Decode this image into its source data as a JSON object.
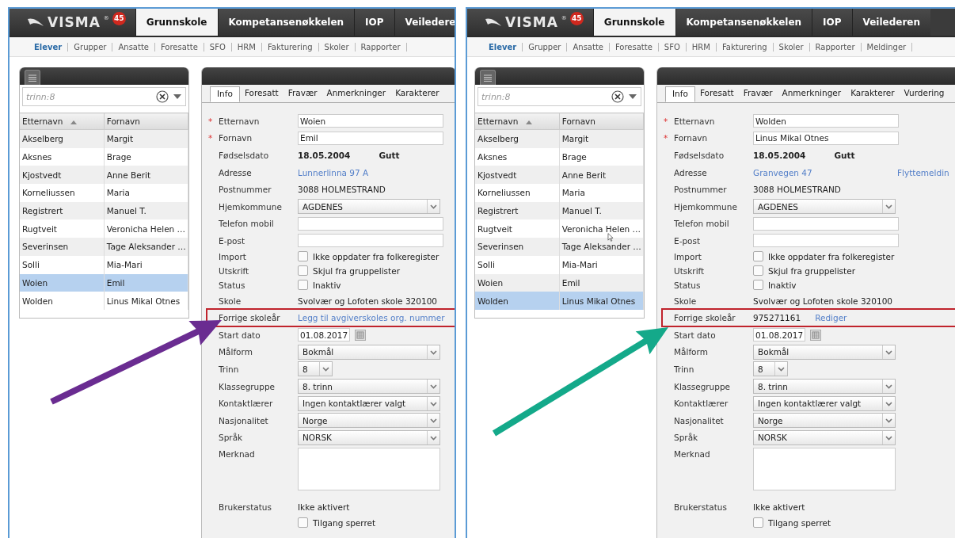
{
  "screens": [
    {
      "logo": {
        "text": "VISMA",
        "mark": "®",
        "badge": "45"
      },
      "top_tabs": [
        {
          "label": "Grunnskole",
          "selected": true
        },
        {
          "label": "Kompetansenøkkelen",
          "selected": false
        },
        {
          "label": "IOP",
          "selected": false
        },
        {
          "label": "Veiledere",
          "selected": false
        }
      ],
      "sub_nav": [
        {
          "label": "Elever",
          "selected": true
        },
        {
          "label": "Grupper",
          "selected": false
        },
        {
          "label": "Ansatte",
          "selected": false
        },
        {
          "label": "Foresatte",
          "selected": false
        },
        {
          "label": "SFO",
          "selected": false
        },
        {
          "label": "HRM",
          "selected": false
        },
        {
          "label": "Fakturering",
          "selected": false
        },
        {
          "label": "Skoler",
          "selected": false
        },
        {
          "label": "Rapporter",
          "selected": false
        }
      ],
      "search": {
        "placeholder": "trinn:8"
      },
      "list": {
        "columns": [
          {
            "label": "Etternavn",
            "sorted": true
          },
          {
            "label": "Fornavn",
            "sorted": false
          }
        ],
        "rows": [
          {
            "cells": [
              "Akselberg",
              "Margit"
            ],
            "selected": false
          },
          {
            "cells": [
              "Aksnes",
              "Brage"
            ],
            "selected": false
          },
          {
            "cells": [
              "Kjostvedt",
              "Anne Berit"
            ],
            "selected": false
          },
          {
            "cells": [
              "Korneliussen",
              "Maria"
            ],
            "selected": false
          },
          {
            "cells": [
              "Registrert",
              "Manuel T."
            ],
            "selected": false
          },
          {
            "cells": [
              "Rugtveit",
              "Veronicha Helen …"
            ],
            "selected": false
          },
          {
            "cells": [
              "Severinsen",
              "Tage Aleksander …"
            ],
            "selected": false
          },
          {
            "cells": [
              "Solli",
              "Mia-Mari"
            ],
            "selected": false
          },
          {
            "cells": [
              "Woien",
              "Emil"
            ],
            "selected": true
          },
          {
            "cells": [
              "Wolden",
              "Linus Mikal Otnes"
            ],
            "selected": false
          }
        ]
      },
      "detail_tabs": [
        {
          "label": "Info",
          "selected": true
        },
        {
          "label": "Foresatt",
          "selected": false
        },
        {
          "label": "Fravær",
          "selected": false
        },
        {
          "label": "Anmerkninger",
          "selected": false
        },
        {
          "label": "Karakterer",
          "selected": false
        }
      ],
      "fields": [
        {
          "kind": "input",
          "marker": "*",
          "label": "Etternavn",
          "value": "Woien"
        },
        {
          "kind": "input",
          "marker": "*",
          "label": "Fornavn",
          "value": "Emil"
        },
        {
          "kind": "birth",
          "label": "Fødselsdato",
          "value": "18.05.2004",
          "extra": "Gutt"
        },
        {
          "kind": "link",
          "label": "Adresse",
          "value": "Lunnerlinna 97 A"
        },
        {
          "kind": "text",
          "label": "Postnummer",
          "value": "3088 HOLMESTRAND"
        },
        {
          "kind": "select",
          "label": "Hjemkommune",
          "value": "AGDENES"
        },
        {
          "kind": "input",
          "label": "Telefon mobil"
        },
        {
          "kind": "input",
          "label": "E-post"
        },
        {
          "kind": "checkbox",
          "label": "Import",
          "value": "Ikke oppdater fra folkeregister",
          "checked": false
        },
        {
          "kind": "checkbox",
          "label": "Utskrift",
          "value": "Skjul fra gruppelister",
          "checked": false
        },
        {
          "kind": "checkbox",
          "label": "Status",
          "value": "Inaktiv",
          "checked": false
        },
        {
          "kind": "text",
          "label": "Skole",
          "value": "Svolvær og Lofoten skole 320100"
        },
        {
          "kind": "link",
          "label": "Forrige skoleår",
          "value": "Legg til avgiverskoles org. nummer",
          "highlighted": true
        },
        {
          "kind": "date",
          "label": "Start dato",
          "value": "01.08.2017"
        },
        {
          "kind": "select",
          "label": "Målform",
          "value": "Bokmål"
        },
        {
          "kind": "small-select",
          "label": "Trinn",
          "value": "8"
        },
        {
          "kind": "select",
          "label": "Klassegruppe",
          "value": "8. trinn"
        },
        {
          "kind": "select",
          "label": "Kontaktlærer",
          "value": "Ingen kontaktlærer valgt"
        },
        {
          "kind": "select",
          "label": "Nasjonalitet",
          "value": "Norge"
        },
        {
          "kind": "select",
          "label": "Språk",
          "value": "NORSK"
        },
        {
          "kind": "textarea",
          "label": "Merknad"
        },
        {
          "kind": "text",
          "label": "Brukerstatus",
          "value": "Ikke aktivert"
        },
        {
          "kind": "checkbox",
          "value": "Tilgang sperret",
          "checked": false
        }
      ],
      "arrow": {
        "color": "#6a2c91"
      }
    },
    {
      "logo": {
        "text": "VISMA",
        "mark": "®",
        "badge": "45"
      },
      "top_tabs": [
        {
          "label": "Grunnskole",
          "selected": true
        },
        {
          "label": "Kompetansenøkkelen",
          "selected": false
        },
        {
          "label": "IOP",
          "selected": false
        },
        {
          "label": "Veilederen",
          "selected": false
        }
      ],
      "sub_nav": [
        {
          "label": "Elever",
          "selected": true
        },
        {
          "label": "Grupper",
          "selected": false
        },
        {
          "label": "Ansatte",
          "selected": false
        },
        {
          "label": "Foresatte",
          "selected": false
        },
        {
          "label": "SFO",
          "selected": false
        },
        {
          "label": "HRM",
          "selected": false
        },
        {
          "label": "Fakturering",
          "selected": false
        },
        {
          "label": "Skoler",
          "selected": false
        },
        {
          "label": "Rapporter",
          "selected": false
        },
        {
          "label": "Meldinger",
          "selected": false
        }
      ],
      "search": {
        "placeholder": "trinn:8"
      },
      "list": {
        "columns": [
          {
            "label": "Etternavn",
            "sorted": true
          },
          {
            "label": "Fornavn",
            "sorted": false
          }
        ],
        "rows": [
          {
            "cells": [
              "Akselberg",
              "Margit"
            ],
            "selected": false
          },
          {
            "cells": [
              "Aksnes",
              "Brage"
            ],
            "selected": false
          },
          {
            "cells": [
              "Kjostvedt",
              "Anne Berit"
            ],
            "selected": false
          },
          {
            "cells": [
              "Korneliussen",
              "Maria"
            ],
            "selected": false
          },
          {
            "cells": [
              "Registrert",
              "Manuel T."
            ],
            "selected": false
          },
          {
            "cells": [
              "Rugtveit",
              "Veronicha Helen …"
            ],
            "selected": false
          },
          {
            "cells": [
              "Severinsen",
              "Tage Aleksander …"
            ],
            "selected": false
          },
          {
            "cells": [
              "Solli",
              "Mia-Mari"
            ],
            "selected": false
          },
          {
            "cells": [
              "Woien",
              "Emil"
            ],
            "selected": false
          },
          {
            "cells": [
              "Wolden",
              "Linus Mikal Otnes"
            ],
            "selected": true
          }
        ]
      },
      "detail_tabs": [
        {
          "label": "Info",
          "selected": true
        },
        {
          "label": "Foresatt",
          "selected": false
        },
        {
          "label": "Fravær",
          "selected": false
        },
        {
          "label": "Anmerkninger",
          "selected": false
        },
        {
          "label": "Karakterer",
          "selected": false
        },
        {
          "label": "Vurdering",
          "selected": false
        }
      ],
      "fields": [
        {
          "kind": "input",
          "marker": "*",
          "label": "Etternavn",
          "value": "Wolden"
        },
        {
          "kind": "input",
          "marker": "*",
          "label": "Fornavn",
          "value": "Linus Mikal Otnes"
        },
        {
          "kind": "birth",
          "label": "Fødselsdato",
          "value": "18.05.2004",
          "extra": "Gutt"
        },
        {
          "kind": "link",
          "label": "Adresse",
          "value": "Granvegen 47",
          "extra": "Flyttemeldin"
        },
        {
          "kind": "text",
          "label": "Postnummer",
          "value": "3088 HOLMESTRAND"
        },
        {
          "kind": "select",
          "label": "Hjemkommune",
          "value": "AGDENES"
        },
        {
          "kind": "input",
          "label": "Telefon mobil"
        },
        {
          "kind": "input",
          "label": "E-post"
        },
        {
          "kind": "checkbox",
          "label": "Import",
          "value": "Ikke oppdater fra folkeregister",
          "checked": false
        },
        {
          "kind": "checkbox",
          "label": "Utskrift",
          "value": "Skjul fra gruppelister",
          "checked": false
        },
        {
          "kind": "checkbox",
          "label": "Status",
          "value": "Inaktiv",
          "checked": false
        },
        {
          "kind": "text",
          "label": "Skole",
          "value": "Svolvær og Lofoten skole 320100"
        },
        {
          "kind": "text-link",
          "label": "Forrige skoleår",
          "value": "975271161",
          "extra": "Rediger",
          "highlighted": true
        },
        {
          "kind": "date",
          "label": "Start dato",
          "value": "01.08.2017"
        },
        {
          "kind": "select",
          "label": "Målform",
          "value": "Bokmål"
        },
        {
          "kind": "small-select",
          "label": "Trinn",
          "value": "8"
        },
        {
          "kind": "select",
          "label": "Klassegruppe",
          "value": "8. trinn"
        },
        {
          "kind": "select",
          "label": "Kontaktlærer",
          "value": "Ingen kontaktlærer valgt"
        },
        {
          "kind": "select",
          "label": "Nasjonalitet",
          "value": "Norge"
        },
        {
          "kind": "select",
          "label": "Språk",
          "value": "NORSK"
        },
        {
          "kind": "textarea",
          "label": "Merknad"
        },
        {
          "kind": "text",
          "label": "Brukerstatus",
          "value": "Ikke aktivert"
        },
        {
          "kind": "checkbox",
          "value": "Tilgang sperret",
          "checked": false
        }
      ],
      "arrow": {
        "color": "#14a98a"
      },
      "mouse_pointer": true
    }
  ]
}
